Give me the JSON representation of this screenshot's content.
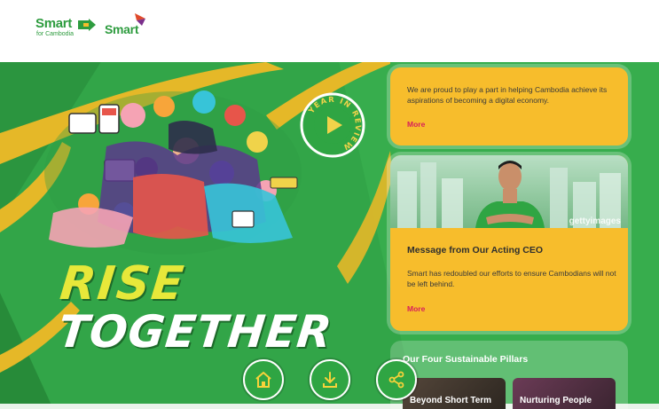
{
  "header": {
    "logo_primary": "Smart",
    "logo_primary_sub": "for Cambodia",
    "logo_secondary": "Smart"
  },
  "hero": {
    "play_badge_text": "YEAR IN REVIEW",
    "title_line1": "RISE",
    "title_line2": "TOGETHER"
  },
  "cards": {
    "intro": {
      "text": "We are proud to play a part in helping Cambodia achieve its aspirations of becoming a digital economy.",
      "more_label": "More"
    },
    "ceo": {
      "photo_watermark": "gettyimages",
      "title": "Message from Our Acting CEO",
      "text": "Smart has redoubled our efforts to ensure Cambodians will not be left behind.",
      "more_label": "More"
    },
    "pillars": {
      "title": "Our Four Sustainable Pillars",
      "items": [
        {
          "label": "Beyond Short Term"
        },
        {
          "label": "Nurturing People"
        }
      ]
    }
  },
  "nav_buttons": [
    {
      "icon": "home-icon"
    },
    {
      "icon": "download-icon"
    },
    {
      "icon": "share-icon"
    }
  ],
  "colors": {
    "brand_green": "#2e9c3f",
    "background_green": "#32a548",
    "card_yellow": "#f7bd2c",
    "accent_pink": "#d81f5a",
    "swoosh_yellow": "#e5b828"
  }
}
